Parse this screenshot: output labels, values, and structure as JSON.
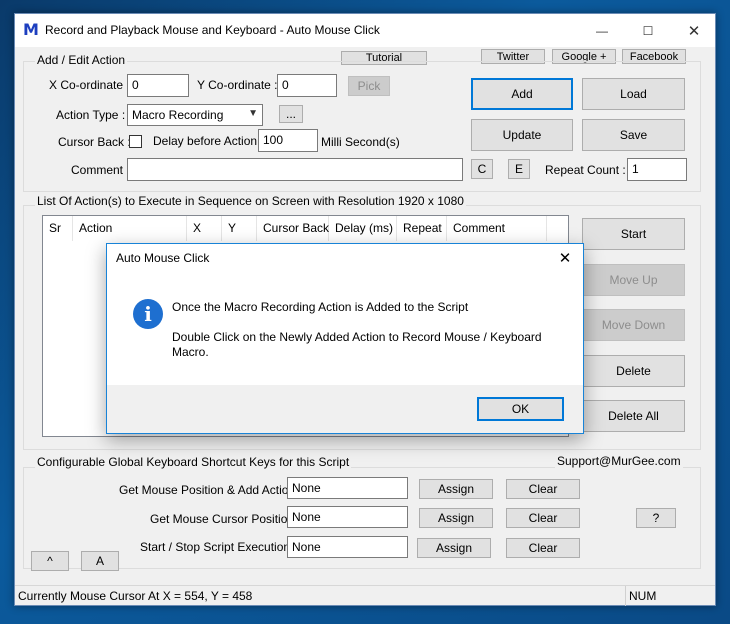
{
  "window": {
    "title": "Record and Playback Mouse and Keyboard - Auto Mouse Click",
    "icon": "M",
    "controls": {
      "minimize": "—",
      "maximize": "☐",
      "close": "✕"
    }
  },
  "top_links": {
    "tutorial": "Tutorial",
    "twitter": "Twitter",
    "google": "Google +",
    "facebook": "Facebook"
  },
  "edit": {
    "group_title": "Add / Edit Action",
    "x_label": "X Co-ordinate :",
    "x_value": "0",
    "y_label": "Y Co-ordinate :",
    "y_value": "0",
    "pick_label": "Pick",
    "action_type_label": "Action Type :",
    "action_type_value": "Macro Recording",
    "more_label": "...",
    "cursor_back_label": "Cursor Back :",
    "delay_label": "Delay before Action :",
    "delay_value": "100",
    "delay_unit": "Milli Second(s)",
    "comment_label": "Comment :",
    "comment_value": "",
    "c_label": "C",
    "e_label": "E",
    "repeat_label": "Repeat Count :",
    "repeat_value": "1"
  },
  "buttons": {
    "add": "Add",
    "load": "Load",
    "update": "Update",
    "save": "Save"
  },
  "list": {
    "group_title": "List Of Action(s) to Execute in Sequence on Screen with Resolution 1920 x 1080",
    "columns": [
      "Sr",
      "Action",
      "X",
      "Y",
      "Cursor Back",
      "Delay (ms)",
      "Repeat",
      "Comment"
    ]
  },
  "side_buttons": {
    "start": "Start",
    "move_up": "Move Up",
    "move_down": "Move Down",
    "delete": "Delete",
    "delete_all": "Delete All"
  },
  "shortcuts": {
    "group_title": "Configurable Global Keyboard Shortcut Keys for this Script",
    "support": "Support@MurGee.com",
    "rows": [
      {
        "label": "Get Mouse Position & Add Action :",
        "value": "None",
        "assign": "Assign",
        "clear": "Clear"
      },
      {
        "label": "Get Mouse Cursor Position :",
        "value": "None",
        "assign": "Assign",
        "clear": "Clear"
      },
      {
        "label": "Start / Stop Script Execution :",
        "value": "None",
        "assign": "Assign",
        "clear": "Clear"
      }
    ],
    "help": "?"
  },
  "bottom_buttons": {
    "caret": "^",
    "a": "A"
  },
  "status": {
    "text": "Currently Mouse Cursor At X = 554, Y = 458",
    "num": "NUM"
  },
  "dialog": {
    "title": "Auto Mouse Click",
    "close": "✕",
    "icon": "i",
    "line1": "Once the Macro Recording Action is Added to the Script",
    "line2": "Double Click on the Newly Added Action to Record Mouse / Keyboard Macro.",
    "ok": "OK"
  }
}
